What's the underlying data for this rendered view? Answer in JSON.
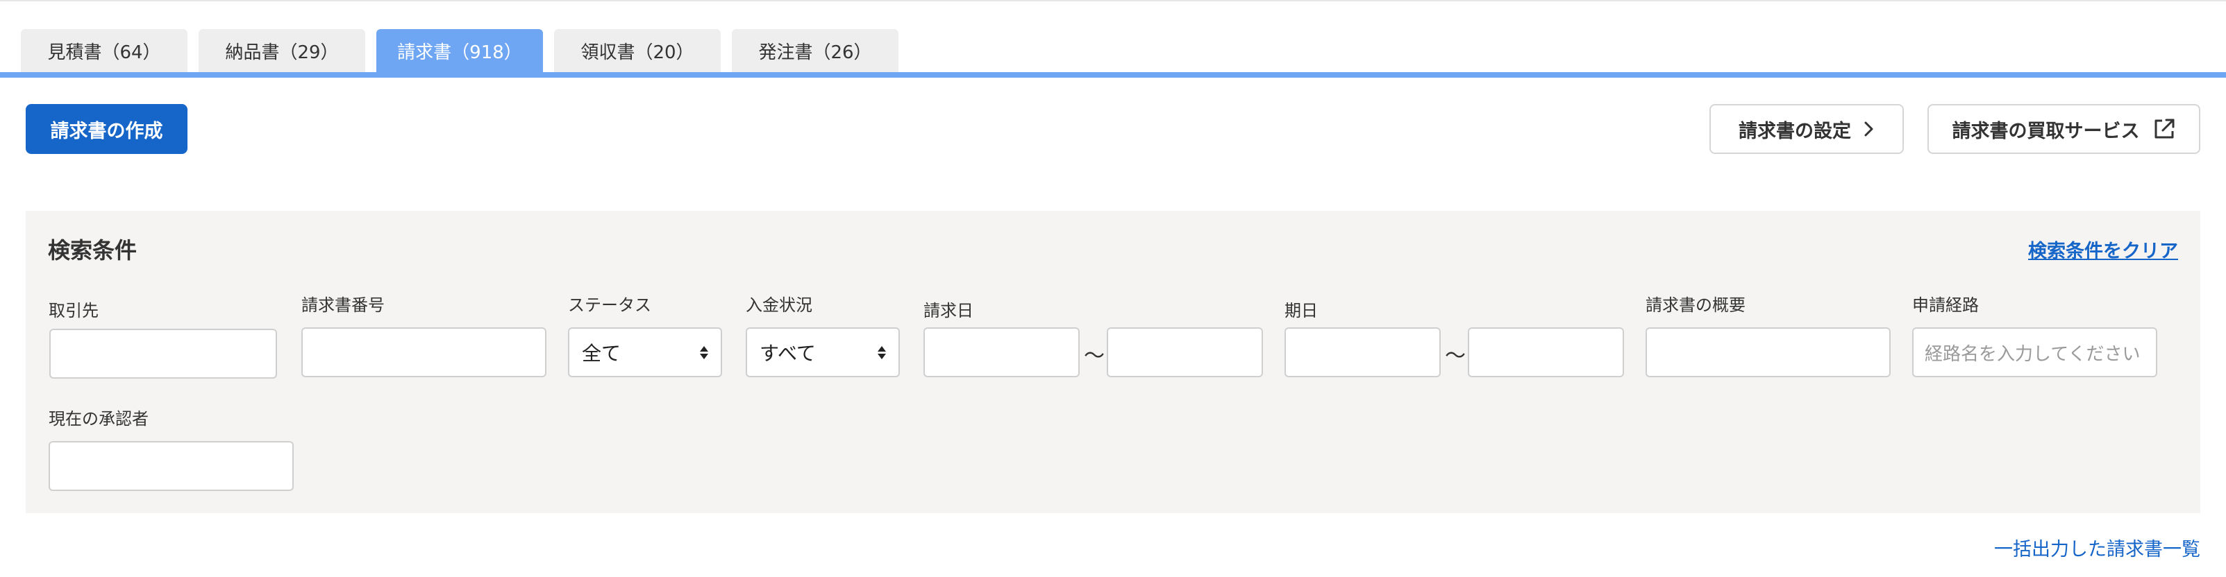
{
  "tabs": [
    {
      "label": "見積書（64）",
      "active": false
    },
    {
      "label": "納品書（29）",
      "active": false
    },
    {
      "label": "請求書（918）",
      "active": true
    },
    {
      "label": "領収書（20）",
      "active": false
    },
    {
      "label": "発注書（26）",
      "active": false
    }
  ],
  "actions": {
    "create_label": "請求書の作成",
    "settings_label": "請求書の設定",
    "factoring_label": "請求書の買取サービス"
  },
  "search": {
    "title": "検索条件",
    "clear_label": "検索条件をクリア",
    "fields": {
      "client": {
        "label": "取引先",
        "value": ""
      },
      "invoice_number": {
        "label": "請求書番号",
        "value": ""
      },
      "status": {
        "label": "ステータス",
        "value": "全て"
      },
      "payment_status": {
        "label": "入金状況",
        "value": "すべて"
      },
      "invoice_date": {
        "label": "請求日",
        "from": "",
        "to": "",
        "separator": "〜"
      },
      "due_date": {
        "label": "期日",
        "from": "",
        "to": "",
        "separator": "〜"
      },
      "summary": {
        "label": "請求書の概要",
        "value": ""
      },
      "route": {
        "label": "申請経路",
        "placeholder": "経路名を入力してください"
      },
      "approver": {
        "label": "現在の承認者",
        "value": ""
      }
    }
  },
  "bulk_export_link": "一括出力した請求書一覧",
  "colors": {
    "accent": "#6ea6f4",
    "primary": "#1665c8",
    "panel_bg": "#f5f4f3"
  }
}
